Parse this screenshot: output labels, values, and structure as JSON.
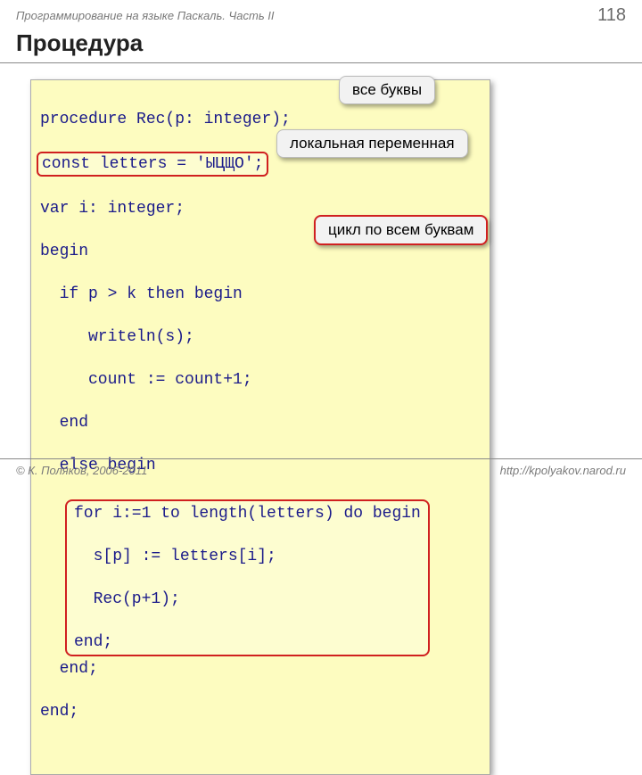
{
  "header": {
    "course": "Программирование на языке Паскаль. Часть II",
    "page": "118"
  },
  "title": "Процедура",
  "code": {
    "l1": "procedure Rec(p: integer);",
    "l2": "const letters = 'ЫЦЩО';",
    "l3": "var i: integer;",
    "l4": "begin",
    "l5": "  if p > k then begin",
    "l6": "     writeln(s);",
    "l7": "     count := count+1;",
    "l8": "  end",
    "l9": "  else begin",
    "l10": "for i:=1 to length(letters) do begin",
    "l11": "  s[p] := letters[i];",
    "l12": "  Rec(p+1);",
    "l13": "end;",
    "l14": "  end;",
    "l15": "end;"
  },
  "callouts": {
    "c1": "все буквы",
    "c2": "локальная переменная",
    "c3": "цикл по всем буквам"
  },
  "footer": {
    "copyright": "© К. Поляков, 2006-2011",
    "url": "http://kpolyakov.narod.ru"
  }
}
